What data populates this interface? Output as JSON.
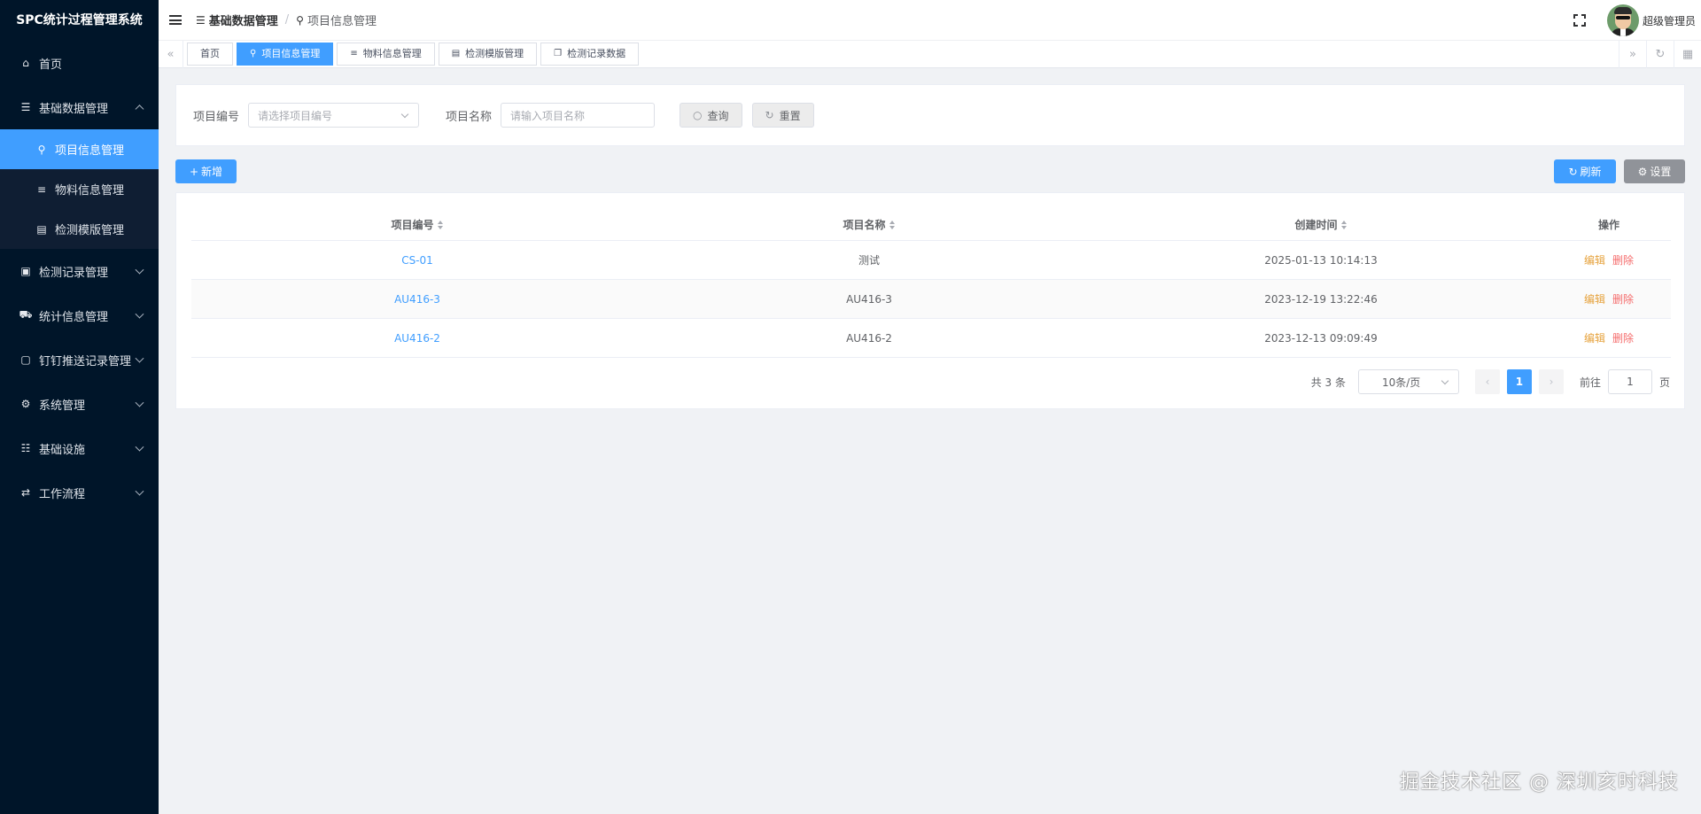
{
  "app": {
    "title": "SPC统计过程管理系统"
  },
  "sidebar": {
    "items": [
      {
        "label": "首页",
        "icon": "home-icon"
      },
      {
        "label": "基础数据管理",
        "icon": "list-icon",
        "expanded": true
      },
      {
        "label": "项目信息管理",
        "icon": "project-icon",
        "active": true
      },
      {
        "label": "物料信息管理",
        "icon": "database-icon"
      },
      {
        "label": "检测模版管理",
        "icon": "document-icon"
      },
      {
        "label": "检测记录管理",
        "icon": "clipboard-icon"
      },
      {
        "label": "统计信息管理",
        "icon": "cart-icon"
      },
      {
        "label": "钉钉推送记录管理",
        "icon": "file-icon"
      },
      {
        "label": "系统管理",
        "icon": "gear-icon"
      },
      {
        "label": "基础设施",
        "icon": "list-icon"
      },
      {
        "label": "工作流程",
        "icon": "flow-icon"
      }
    ]
  },
  "header": {
    "breadcrumb": [
      "基础数据管理",
      "/",
      "项目信息管理"
    ],
    "username": "超级管理员"
  },
  "tags": [
    "首页",
    "项目信息管理",
    "物料信息管理",
    "检测模版管理",
    "检测记录数据"
  ],
  "search": {
    "project_code_label": "项目编号",
    "project_code_placeholder": "请选择项目编号",
    "project_name_label": "项目名称",
    "project_name_placeholder": "请输入项目名称",
    "query_label": "查询",
    "reset_label": "重置"
  },
  "toolbar": {
    "add_label": "新增",
    "refresh_label": "刷新",
    "settings_label": "设置"
  },
  "table": {
    "headers": [
      "项目编号",
      "项目名称",
      "创建时间",
      "操作"
    ],
    "rows": [
      {
        "code": "CS-01",
        "name": "测试",
        "created": "2025-01-13 10:14:13"
      },
      {
        "code": "AU416-3",
        "name": "AU416-3",
        "created": "2023-12-19 13:22:46"
      },
      {
        "code": "AU416-2",
        "name": "AU416-2",
        "created": "2023-12-13 09:09:49"
      }
    ],
    "edit_label": "编辑",
    "delete_label": "删除"
  },
  "pagination": {
    "total_text": "共 3 条",
    "page_size": "10条/页",
    "current_page": "1",
    "goto_label": "前往",
    "goto_value": "1",
    "page_suffix": "页"
  },
  "watermark": "掘金技术社区 @ 深圳亥时科技",
  "colors": {
    "primary": "#409eff",
    "sidebar_bg": "#001529",
    "warning": "#e6a23c",
    "danger": "#f56c6c"
  }
}
